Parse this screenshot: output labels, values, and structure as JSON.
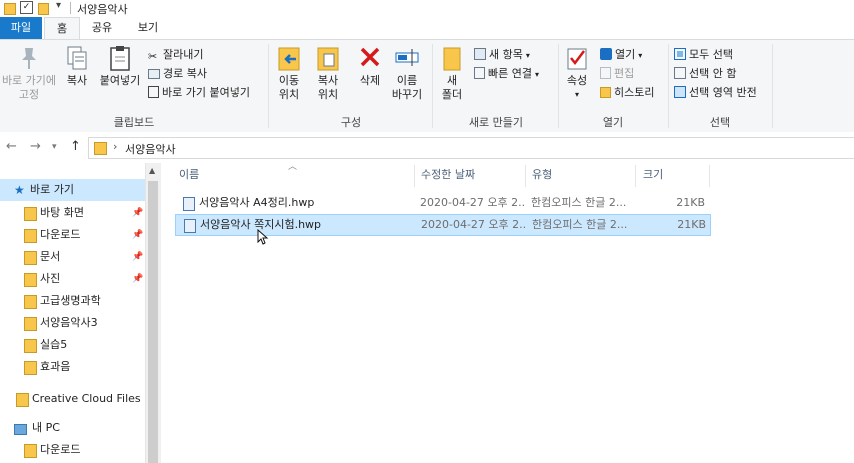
{
  "window": {
    "title": "서양음악사"
  },
  "tabs": [
    {
      "label": "파일"
    },
    {
      "label": "홈"
    },
    {
      "label": "공유"
    },
    {
      "label": "보기"
    }
  ],
  "ribbon": {
    "clipboard": {
      "label": "클립보드",
      "pin": "바로 가기에\n고정",
      "copy": "복사",
      "paste": "붙여넣기",
      "cut": "잘라내기",
      "copy_path": "경로 복사",
      "paste_shortcut": "바로 가기 붙여넣기"
    },
    "organize": {
      "label": "구성",
      "move": "이동\n위치",
      "copyto": "복사\n위치",
      "delete": "삭제",
      "rename": "이름\n바꾸기"
    },
    "new": {
      "label": "새로 만들기",
      "new_folder": "새\n폴더",
      "new_item": "새 항목",
      "easy_access": "빠른 연결"
    },
    "open": {
      "label": "열기",
      "properties": "속성",
      "open": "열기",
      "edit": "편집",
      "history": "히스토리"
    },
    "select": {
      "label": "선택",
      "all": "모두 선택",
      "none": "선택 안 함",
      "invert": "선택 영역 반전"
    }
  },
  "address": {
    "path": "서양음악사"
  },
  "nav": {
    "quick_access": "바로 가기",
    "items": [
      {
        "label": "바탕 화면",
        "pinned": true
      },
      {
        "label": "다운로드",
        "pinned": true
      },
      {
        "label": "문서",
        "pinned": true
      },
      {
        "label": "사진",
        "pinned": true
      },
      {
        "label": "고급생명과학",
        "pinned": false
      },
      {
        "label": "서양음악사3",
        "pinned": false
      },
      {
        "label": "실습5",
        "pinned": false
      },
      {
        "label": "효과음",
        "pinned": false
      }
    ],
    "creative_cloud": "Creative Cloud Files",
    "this_pc": "내 PC",
    "pc_download": "다운로드"
  },
  "list": {
    "columns": [
      "이름",
      "수정한 날짜",
      "유형",
      "크기"
    ],
    "rows": [
      {
        "name": "서양음악사 A4정리.hwp",
        "date": "2020-04-27 오후 2...",
        "type": "한컴오피스 한글 2...",
        "size": "21KB",
        "selected": false
      },
      {
        "name": "서양음악사 쪽지시험.hwp",
        "date": "2020-04-27 오후 2...",
        "type": "한컴오피스 한글 2...",
        "size": "21KB",
        "selected": true
      }
    ]
  },
  "colors": {
    "accent": "#1979ca",
    "selection": "#cce8ff",
    "folder": "#f7c64a"
  }
}
